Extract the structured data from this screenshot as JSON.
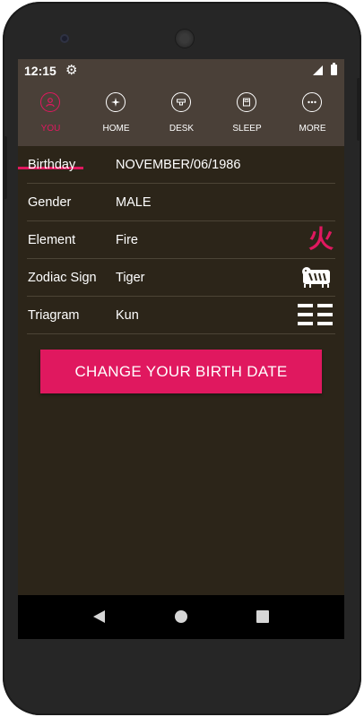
{
  "status": {
    "time": "12:15"
  },
  "tabs": [
    {
      "label": "YOU",
      "icon": "person-icon",
      "active": true
    },
    {
      "label": "HOME",
      "icon": "compass-icon",
      "active": false
    },
    {
      "label": "DESK",
      "icon": "desk-icon",
      "active": false
    },
    {
      "label": "SLEEP",
      "icon": "bed-icon",
      "active": false
    },
    {
      "label": "MORE",
      "icon": "more-icon",
      "active": false
    }
  ],
  "profile": {
    "birthday": {
      "label": "Birthday",
      "value": "NOVEMBER/06/1986"
    },
    "gender": {
      "label": "Gender",
      "value": "MALE"
    },
    "element": {
      "label": "Element",
      "value": "Fire",
      "symbol": "火",
      "symbol_color": "#e0185f"
    },
    "zodiac": {
      "label": "Zodiac Sign",
      "value": "Tiger",
      "icon": "tiger-icon"
    },
    "trigram": {
      "label": "Triagram",
      "value": "Kun",
      "icon": "kun-trigram-icon"
    }
  },
  "action": {
    "change_birth_date": "CHANGE YOUR BIRTH DATE"
  },
  "colors": {
    "accent": "#e0185f",
    "background": "#2c2519",
    "toolbar": "#4a4038"
  }
}
